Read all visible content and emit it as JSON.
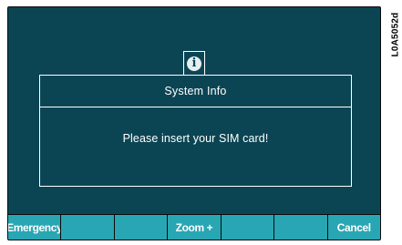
{
  "screen": {
    "background": "#0b4554",
    "softkey_color": "#29a6b3"
  },
  "dialog": {
    "icon": "info-icon",
    "icon_glyph": "i",
    "title": "System Info",
    "message": "Please insert your SIM card!"
  },
  "softkeys": [
    {
      "label": "Emergency"
    },
    {
      "label": ""
    },
    {
      "label": ""
    },
    {
      "label": "Zoom +"
    },
    {
      "label": ""
    },
    {
      "label": ""
    },
    {
      "label": "Cancel"
    }
  ],
  "figure_label": "L0A5052d"
}
